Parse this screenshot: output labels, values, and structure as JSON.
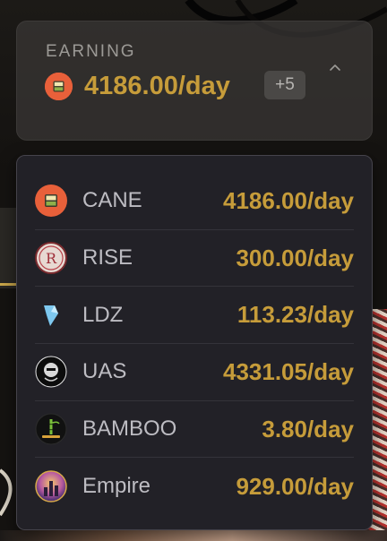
{
  "earning": {
    "label": "EARNING",
    "value": "4186.00/day",
    "more_count": "+5",
    "primary_token_icon": "cane-token-icon",
    "expanded": true
  },
  "tokens": [
    {
      "name": "CANE",
      "rate": "4186.00/day",
      "icon": "cane-token-icon"
    },
    {
      "name": "RISE",
      "rate": "300.00/day",
      "icon": "rise-token-icon"
    },
    {
      "name": "LDZ",
      "rate": "113.23/day",
      "icon": "ldz-token-icon"
    },
    {
      "name": "UAS",
      "rate": "4331.05/day",
      "icon": "uas-token-icon"
    },
    {
      "name": "BAMBOO",
      "rate": "3.80/day",
      "icon": "bamboo-token-icon"
    },
    {
      "name": "Empire",
      "rate": "929.00/day",
      "icon": "empire-token-icon"
    }
  ],
  "colors": {
    "accent_gold": "#c69c3a",
    "card_bg": "#3a3836",
    "dropdown_bg": "#222127",
    "text_muted": "#9c9a96"
  }
}
